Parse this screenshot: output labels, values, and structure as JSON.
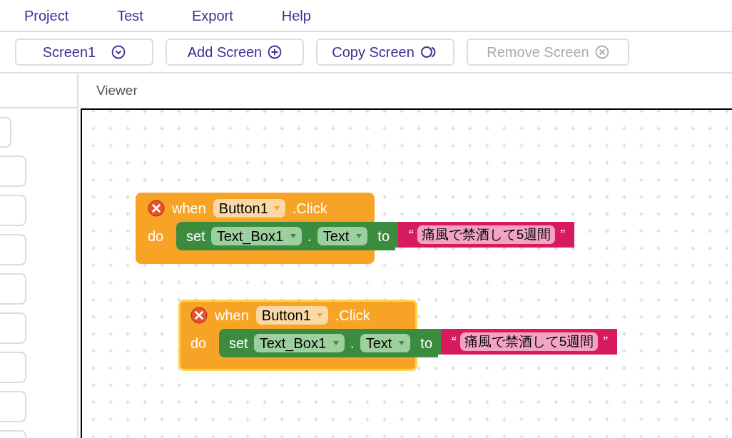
{
  "menu": [
    "Project",
    "Test",
    "Export",
    "Help"
  ],
  "toolbar": [
    {
      "label": "Screen1",
      "kind": "dropdown",
      "disabled": false
    },
    {
      "label": "Add Screen",
      "kind": "add",
      "disabled": false
    },
    {
      "label": "Copy Screen",
      "kind": "copy",
      "disabled": false
    },
    {
      "label": "Remove Screen",
      "kind": "remove",
      "disabled": true
    }
  ],
  "viewer": {
    "title": "Viewer"
  },
  "blocks": [
    {
      "selected": false,
      "when": "when",
      "component": "Button1",
      "event": ".Click",
      "do": "do",
      "set": "set",
      "target": "Text_Box1",
      "dot": ".",
      "property": "Text",
      "to": "to",
      "quote_open": "“",
      "value": "痛風で禁酒して5週間",
      "quote_close": "”"
    },
    {
      "selected": true,
      "when": "when",
      "component": "Button1",
      "event": ".Click",
      "do": "do",
      "set": "set",
      "target": "Text_Box1",
      "dot": ".",
      "property": "Text",
      "to": "to",
      "quote_open": "“",
      "value": "痛風で禁酒して5週間",
      "quote_close": "”"
    }
  ]
}
